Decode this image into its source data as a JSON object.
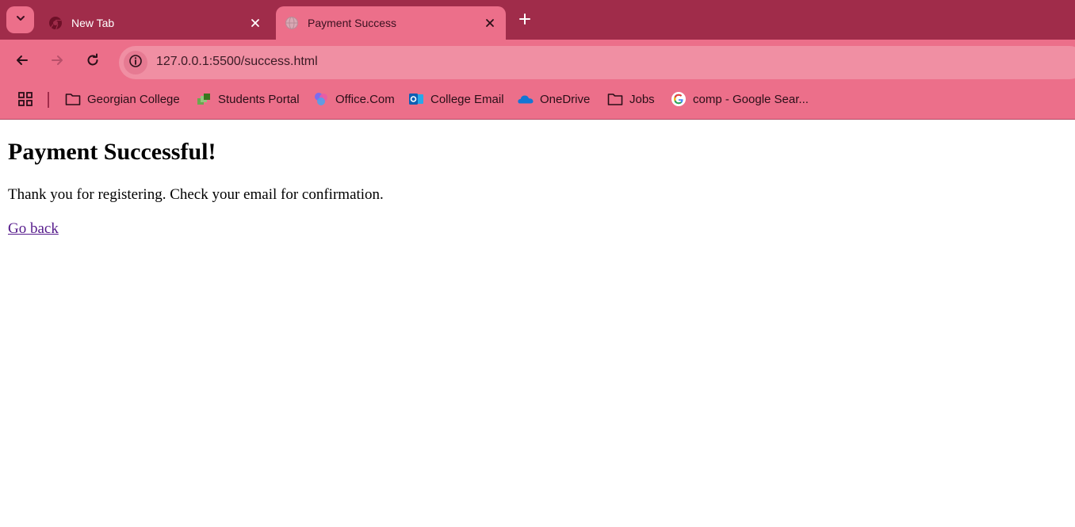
{
  "browser": {
    "tabs": [
      {
        "title": "New Tab",
        "active": false,
        "favicon": "chrome-icon"
      },
      {
        "title": "Payment Success",
        "active": true,
        "favicon": "globe-icon"
      }
    ],
    "address_bar": {
      "url": "127.0.0.1:5500/success.html"
    },
    "bookmarks": [
      {
        "label": "Georgian College",
        "icon": "folder-icon"
      },
      {
        "label": "Students Portal",
        "icon": "students-portal-icon"
      },
      {
        "label": "Office.Com",
        "icon": "office-icon"
      },
      {
        "label": "College Email",
        "icon": "outlook-icon"
      },
      {
        "label": "OneDrive",
        "icon": "onedrive-icon"
      },
      {
        "label": "Jobs",
        "icon": "folder-icon"
      },
      {
        "label": "comp - Google Sear...",
        "icon": "google-icon"
      }
    ],
    "colors": {
      "tabstrip": "#a02c4a",
      "toolbar": "#ec6f8a",
      "omnibox": "#f08fa3"
    }
  },
  "page": {
    "heading": "Payment Successful!",
    "message": "Thank you for registering. Check your email for confirmation.",
    "link": "Go back",
    "link_color": "#551a8b"
  }
}
